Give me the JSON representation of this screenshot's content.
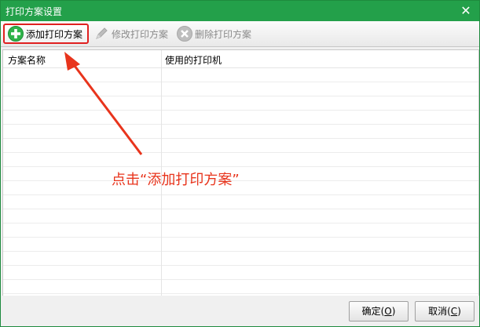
{
  "window": {
    "title": "打印方案设置",
    "close_glyph": "✕"
  },
  "toolbar": {
    "add_label": "添加打印方案",
    "edit_label": "修改打印方案",
    "delete_label": "删除打印方案",
    "add_icon": "plus-circle-icon",
    "edit_icon": "pencil-icon",
    "delete_icon": "x-circle-icon"
  },
  "grid": {
    "columns": [
      "方案名称",
      "使用的打印机"
    ],
    "rows": []
  },
  "annotation": {
    "text": "点击“添加打印方案”",
    "color": "#e8341c"
  },
  "footer": {
    "ok_text": "确定(",
    "ok_key": "O",
    "ok_close": ")",
    "cancel_text": "取消(",
    "cancel_key": "C",
    "cancel_close": ")"
  },
  "colors": {
    "titlebar": "#23a04a",
    "highlight": "#e02020"
  }
}
